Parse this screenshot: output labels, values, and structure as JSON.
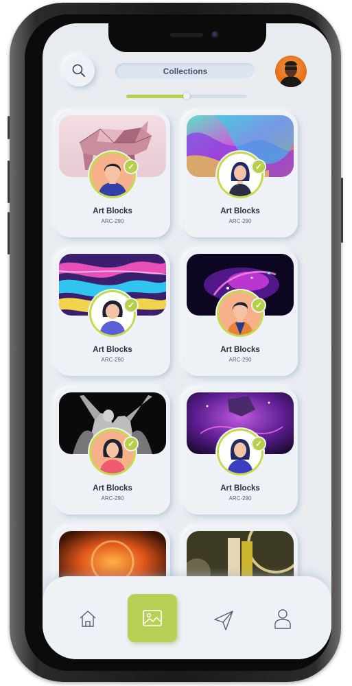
{
  "header": {
    "title": "Collections",
    "search_icon": "search-icon",
    "avatar_icon": "profile-avatar"
  },
  "slider": {
    "value": 0.5
  },
  "collections": [
    {
      "name": "Art Blocks",
      "code": "ARC-290",
      "art": "pink-geometric-rhino",
      "verified": true
    },
    {
      "name": "Art Blocks",
      "code": "ARC-290",
      "art": "colorful-3d-waves",
      "verified": true
    },
    {
      "name": "Art Blocks",
      "code": "ARC-290",
      "art": "holographic-liquid",
      "verified": true
    },
    {
      "name": "Art Blocks",
      "code": "ARC-290",
      "art": "neon-particle-figure",
      "verified": true
    },
    {
      "name": "Art Blocks",
      "code": "ARC-290",
      "art": "angel-statue",
      "verified": true
    },
    {
      "name": "Art Blocks",
      "code": "ARC-290",
      "art": "purple-galaxy",
      "verified": true
    },
    {
      "name": "",
      "code": "",
      "art": "fiery-orange-sphere",
      "verified": false
    },
    {
      "name": "",
      "code": "",
      "art": "clock-couple-scene",
      "verified": false
    }
  ],
  "nav": [
    {
      "icon": "home-icon"
    },
    {
      "icon": "gallery-icon",
      "active": true
    },
    {
      "icon": "send-icon"
    },
    {
      "icon": "user-icon"
    }
  ],
  "colors": {
    "accent": "#b8d055",
    "screen_bg": "#e8ecf1",
    "card_bg": "#eef1f5",
    "title_pill": "#dde3f0"
  }
}
